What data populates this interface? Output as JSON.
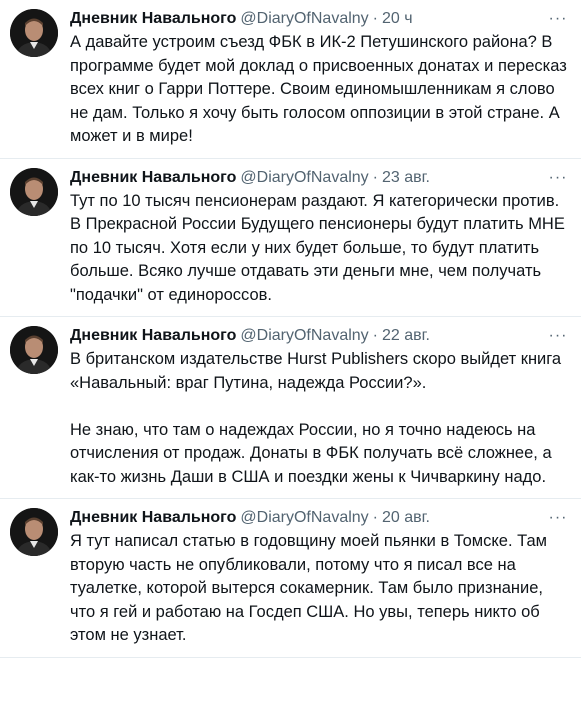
{
  "tweets": [
    {
      "name": "Дневник Навального",
      "handle": "@DiaryOfNavalny",
      "sep": "·",
      "time": "20 ч",
      "more": "···",
      "text": "А давайте устроим съезд ФБК в ИК-2 Петушинского района? В программе будет мой доклад о присвоенных донатах и пересказ всех книг о Гарри Поттере. Своим единомышленникам я слово не дам. Только я хочу быть голосом оппозиции в этой стране. А может и в мире!"
    },
    {
      "name": "Дневник Навального",
      "handle": "@DiaryOfNavalny",
      "sep": "·",
      "time": "23 авг.",
      "more": "···",
      "text": "Тут по 10 тысяч пенсионерам раздают. Я категорически против. В Прекрасной России Будущего пенсионеры будут платить МНЕ по 10 тысяч. Хотя если у них будет больше, то будут платить больше. Всяко лучше отдавать эти деньги мне, чем получать \"подачки\" от единороссов."
    },
    {
      "name": "Дневник Навального",
      "handle": "@DiaryOfNavalny",
      "sep": "·",
      "time": "22 авг.",
      "more": "···",
      "text": "В британском издательстве Hurst Publishers скоро выйдет книга «Навальный: враг Путина, надежда России?».\n\nНе знаю, что там о надеждах России, но я точно надеюсь на отчисления от продаж. Донаты в ФБК получать всё сложнее, а как-то жизнь Даши в США и поездки жены к Чичваркину надо."
    },
    {
      "name": "Дневник Навального",
      "handle": "@DiaryOfNavalny",
      "sep": "·",
      "time": "20 авг.",
      "more": "···",
      "text": "Я тут написал статью в годовщину моей пьянки в Томске. Там вторую часть не опубликовали, потому что я писал все на туалетке, которой вытерся сокамерник. Там было признание, что я гей и работаю на Госдеп США. Но увы, теперь никто об этом не узнает."
    }
  ]
}
